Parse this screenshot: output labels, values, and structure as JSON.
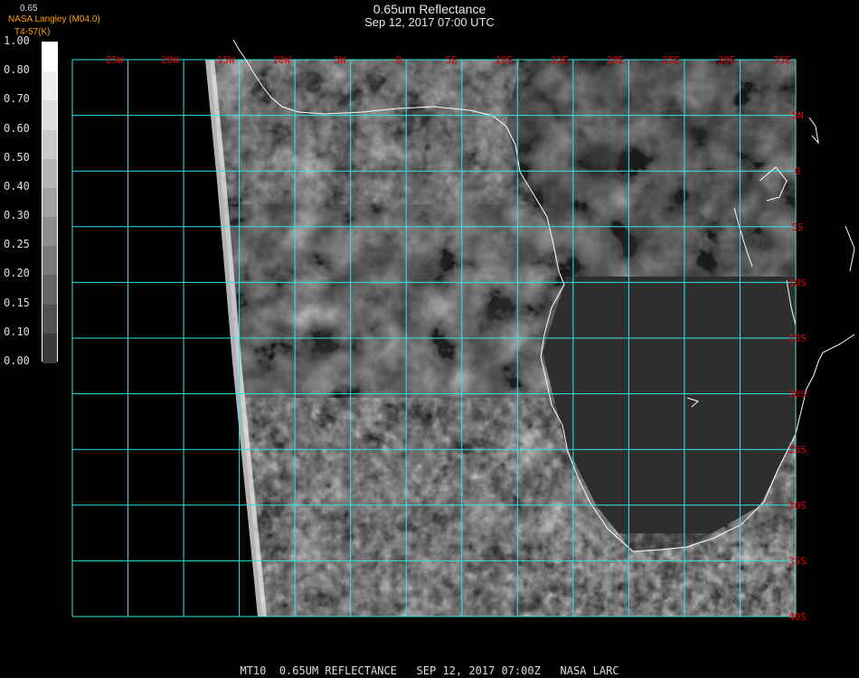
{
  "header": {
    "title": "0.65um Reflectance",
    "subtitle": "Sep 12, 2017 07:00 UTC",
    "credit": "NASA Langley (M04.0)",
    "credit2": "T4-57(K)",
    "top_value": "0.65"
  },
  "colorbar": {
    "labels": [
      "1.00",
      "0.80",
      "0.70",
      "0.60",
      "0.50",
      "0.40",
      "0.30",
      "0.25",
      "0.20",
      "0.15",
      "0.10",
      "0.00"
    ],
    "shades": [
      "#ffffff",
      "#eeeeee",
      "#dddddd",
      "#c8c8c8",
      "#b4b4b4",
      "#a0a0a0",
      "#8c8c8c",
      "#787878",
      "#646464",
      "#505050",
      "#3a3a3a",
      "#000000"
    ]
  },
  "map": {
    "lon_labels": [
      "25W",
      "20W",
      "15W",
      "10W",
      "5W",
      "0",
      "5E",
      "10E",
      "15E",
      "20E",
      "25E",
      "30E",
      "35E"
    ],
    "lat_labels": [
      "5N",
      "0",
      "5S",
      "10S",
      "15S",
      "20S",
      "25S",
      "30S",
      "35S",
      "40S"
    ],
    "grid_color": "#33e6e6",
    "label_color": "#e00000",
    "coast_color": "#ffffff"
  },
  "footer": {
    "text": "MT10  0.65UM REFLECTANCE   SEP 12, 2017 07:00Z   NASA LARC"
  }
}
